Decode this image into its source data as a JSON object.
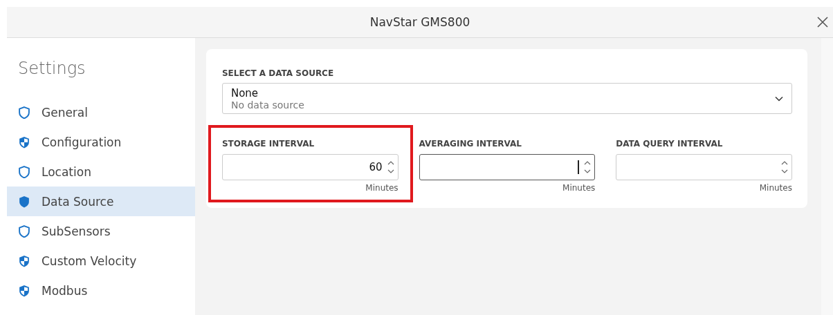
{
  "window": {
    "title": "NavStar GMS800"
  },
  "sidebar": {
    "title": "Settings",
    "items": [
      {
        "label": "General",
        "kind": "outline",
        "selected": false
      },
      {
        "label": "Configuration",
        "kind": "partial",
        "selected": false
      },
      {
        "label": "Location",
        "kind": "outline",
        "selected": false
      },
      {
        "label": "Data Source",
        "kind": "filled",
        "selected": true
      },
      {
        "label": "SubSensors",
        "kind": "outline",
        "selected": false
      },
      {
        "label": "Custom Velocity",
        "kind": "partial",
        "selected": false
      },
      {
        "label": "Modbus",
        "kind": "partial",
        "selected": false
      }
    ]
  },
  "data_source": {
    "label": "SELECT A DATA SOURCE",
    "value": "None",
    "description": "No data source"
  },
  "intervals": [
    {
      "label": "STORAGE INTERVAL",
      "value": "60",
      "unit": "Minutes",
      "highlighted": true,
      "focused": false
    },
    {
      "label": "AVERAGING INTERVAL",
      "unit": "Minutes",
      "highlighted": false,
      "focused": true
    },
    {
      "label": "DATA QUERY INTERVAL",
      "unit": "Minutes",
      "highlighted": false,
      "focused": false
    }
  ]
}
